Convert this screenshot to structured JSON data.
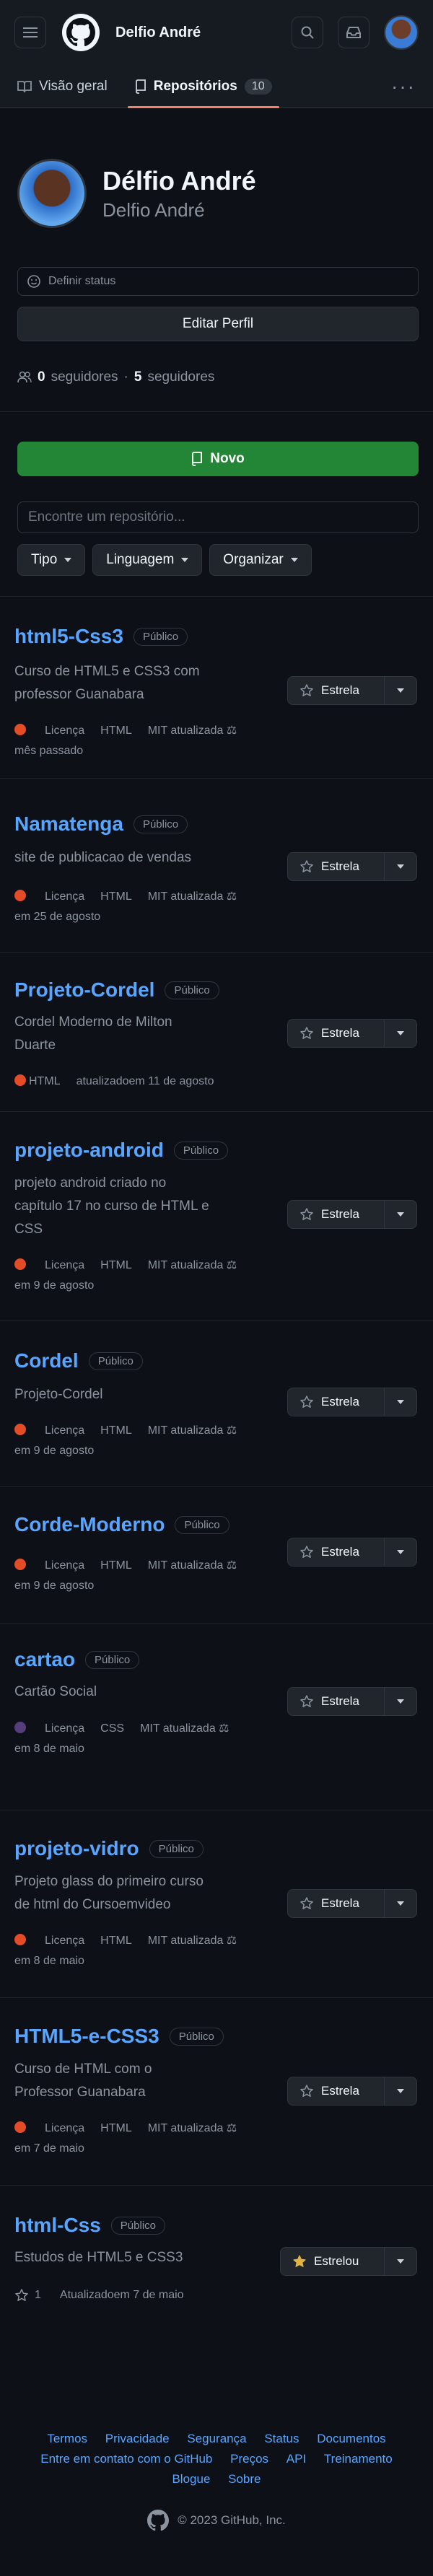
{
  "header": {
    "username": "Delfio André"
  },
  "tabs": [
    {
      "label": "Visão geral"
    },
    {
      "label": "Repositórios",
      "count": "10"
    }
  ],
  "profile": {
    "name": "Délfio André",
    "login": "Delfio André",
    "status_label": "Definir status",
    "edit_label": "Editar Perfil",
    "followers_count": "0",
    "followers_label": "seguidores",
    "following_count": "5",
    "following_label": "seguidores"
  },
  "actions": {
    "new_label": "Novo",
    "search_placeholder": "Encontre um repositório...",
    "filters": [
      "Tipo",
      "Linguagem",
      "Organizar"
    ]
  },
  "repos": [
    {
      "name": "html5-Css3",
      "visibility": "Público",
      "desc1": "Curso de HTML5 e CSS3 com",
      "desc2": "professor Guanabara",
      "desc3": "",
      "license": "Licença",
      "language": "HTML",
      "lang_color": "#e34c26",
      "updated1": "MIT atualizada",
      "updated2": "mês passado",
      "star_label": "Estrela"
    },
    {
      "name": "Namatenga",
      "visibility": "Público",
      "desc1": "site de publicacao de vendas",
      "desc2": "",
      "desc3": "",
      "license": "Licença",
      "language": "HTML",
      "lang_color": "#e34c26",
      "updated1": "MIT atualizada",
      "updated2": "em 25 de agosto",
      "star_label": "Estrela"
    },
    {
      "name": "Projeto-Cordel",
      "visibility": "Público",
      "desc1": "Cordel Moderno de Milton",
      "desc2": "Duarte",
      "desc3": "",
      "license": "",
      "language": "HTML",
      "lang_color": "#e34c26",
      "updated1": "atualizadoem 11 de agosto",
      "updated2": "",
      "star_label": "Estrela"
    },
    {
      "name": "projeto-android",
      "visibility": "Público",
      "desc1": "projeto android criado no",
      "desc2": "capítulo 17 no curso de HTML e",
      "desc3": "CSS",
      "license": "Licença",
      "language": "HTML",
      "lang_color": "#e34c26",
      "updated1": "MIT atualizada",
      "updated2": "em 9 de agosto",
      "star_label": "Estrela"
    },
    {
      "name": "Cordel",
      "visibility": "Público",
      "desc1": "Projeto-Cordel",
      "desc2": "",
      "desc3": "",
      "license": "Licença",
      "language": "HTML",
      "lang_color": "#e34c26",
      "updated1": "MIT atualizada",
      "updated2": "em 9 de agosto",
      "star_label": "Estrela"
    },
    {
      "name": "Corde-Moderno",
      "visibility": "Público",
      "desc1": "",
      "desc2": "",
      "desc3": "",
      "license": "Licença",
      "language": "HTML",
      "lang_color": "#e34c26",
      "updated1": "MIT atualizada",
      "updated2": "em 9 de agosto",
      "star_label": "Estrela"
    },
    {
      "name": "cartao",
      "visibility": "Público",
      "desc1": "Cartão Social",
      "desc2": "",
      "desc3": "",
      "license": "Licença",
      "language": "CSS",
      "lang_color": "#563d7c",
      "updated1": "MIT atualizada",
      "updated2": "em 8 de maio",
      "star_label": "Estrela"
    },
    {
      "name": "projeto-vidro",
      "visibility": "Público",
      "desc1": "Projeto glass do primeiro curso",
      "desc2": "de html do Cursoemvideo",
      "desc3": "",
      "license": "Licença",
      "language": "HTML",
      "lang_color": "#e34c26",
      "updated1": "MIT atualizada",
      "updated2": "em 8 de maio",
      "star_label": "Estrela"
    },
    {
      "name": "HTML5-e-CSS3",
      "visibility": "Público",
      "desc1": "Curso de HTML com o",
      "desc2": "Professor Guanabara",
      "desc3": "",
      "license": "Licença",
      "language": "HTML",
      "lang_color": "#e34c26",
      "updated1": "MIT atualizada",
      "updated2": "em 7 de maio",
      "star_label": "Estrela"
    },
    {
      "name": "html-Css",
      "visibility": "Público",
      "desc1": "Estudos de HTML5 e CSS3",
      "desc2": "",
      "desc3": "",
      "stars": "1",
      "updated1": "Atualizadoem 7 de maio",
      "star_label": "Estrelou"
    }
  ],
  "footer": {
    "row1": [
      "Termos",
      "Privacidade",
      "Segurança",
      "Status",
      "Documentos"
    ],
    "row2": [
      "Entre em contato com o GitHub",
      "Preços",
      "API",
      "Treinamento"
    ],
    "row3": [
      "Blogue",
      "Sobre"
    ],
    "copyright": "© 2023 GitHub, Inc."
  },
  "colors": {
    "accent_link": "#58a6ff",
    "primary_button": "#238636",
    "tab_underline": "#f78166",
    "starred": "#e3b341"
  }
}
